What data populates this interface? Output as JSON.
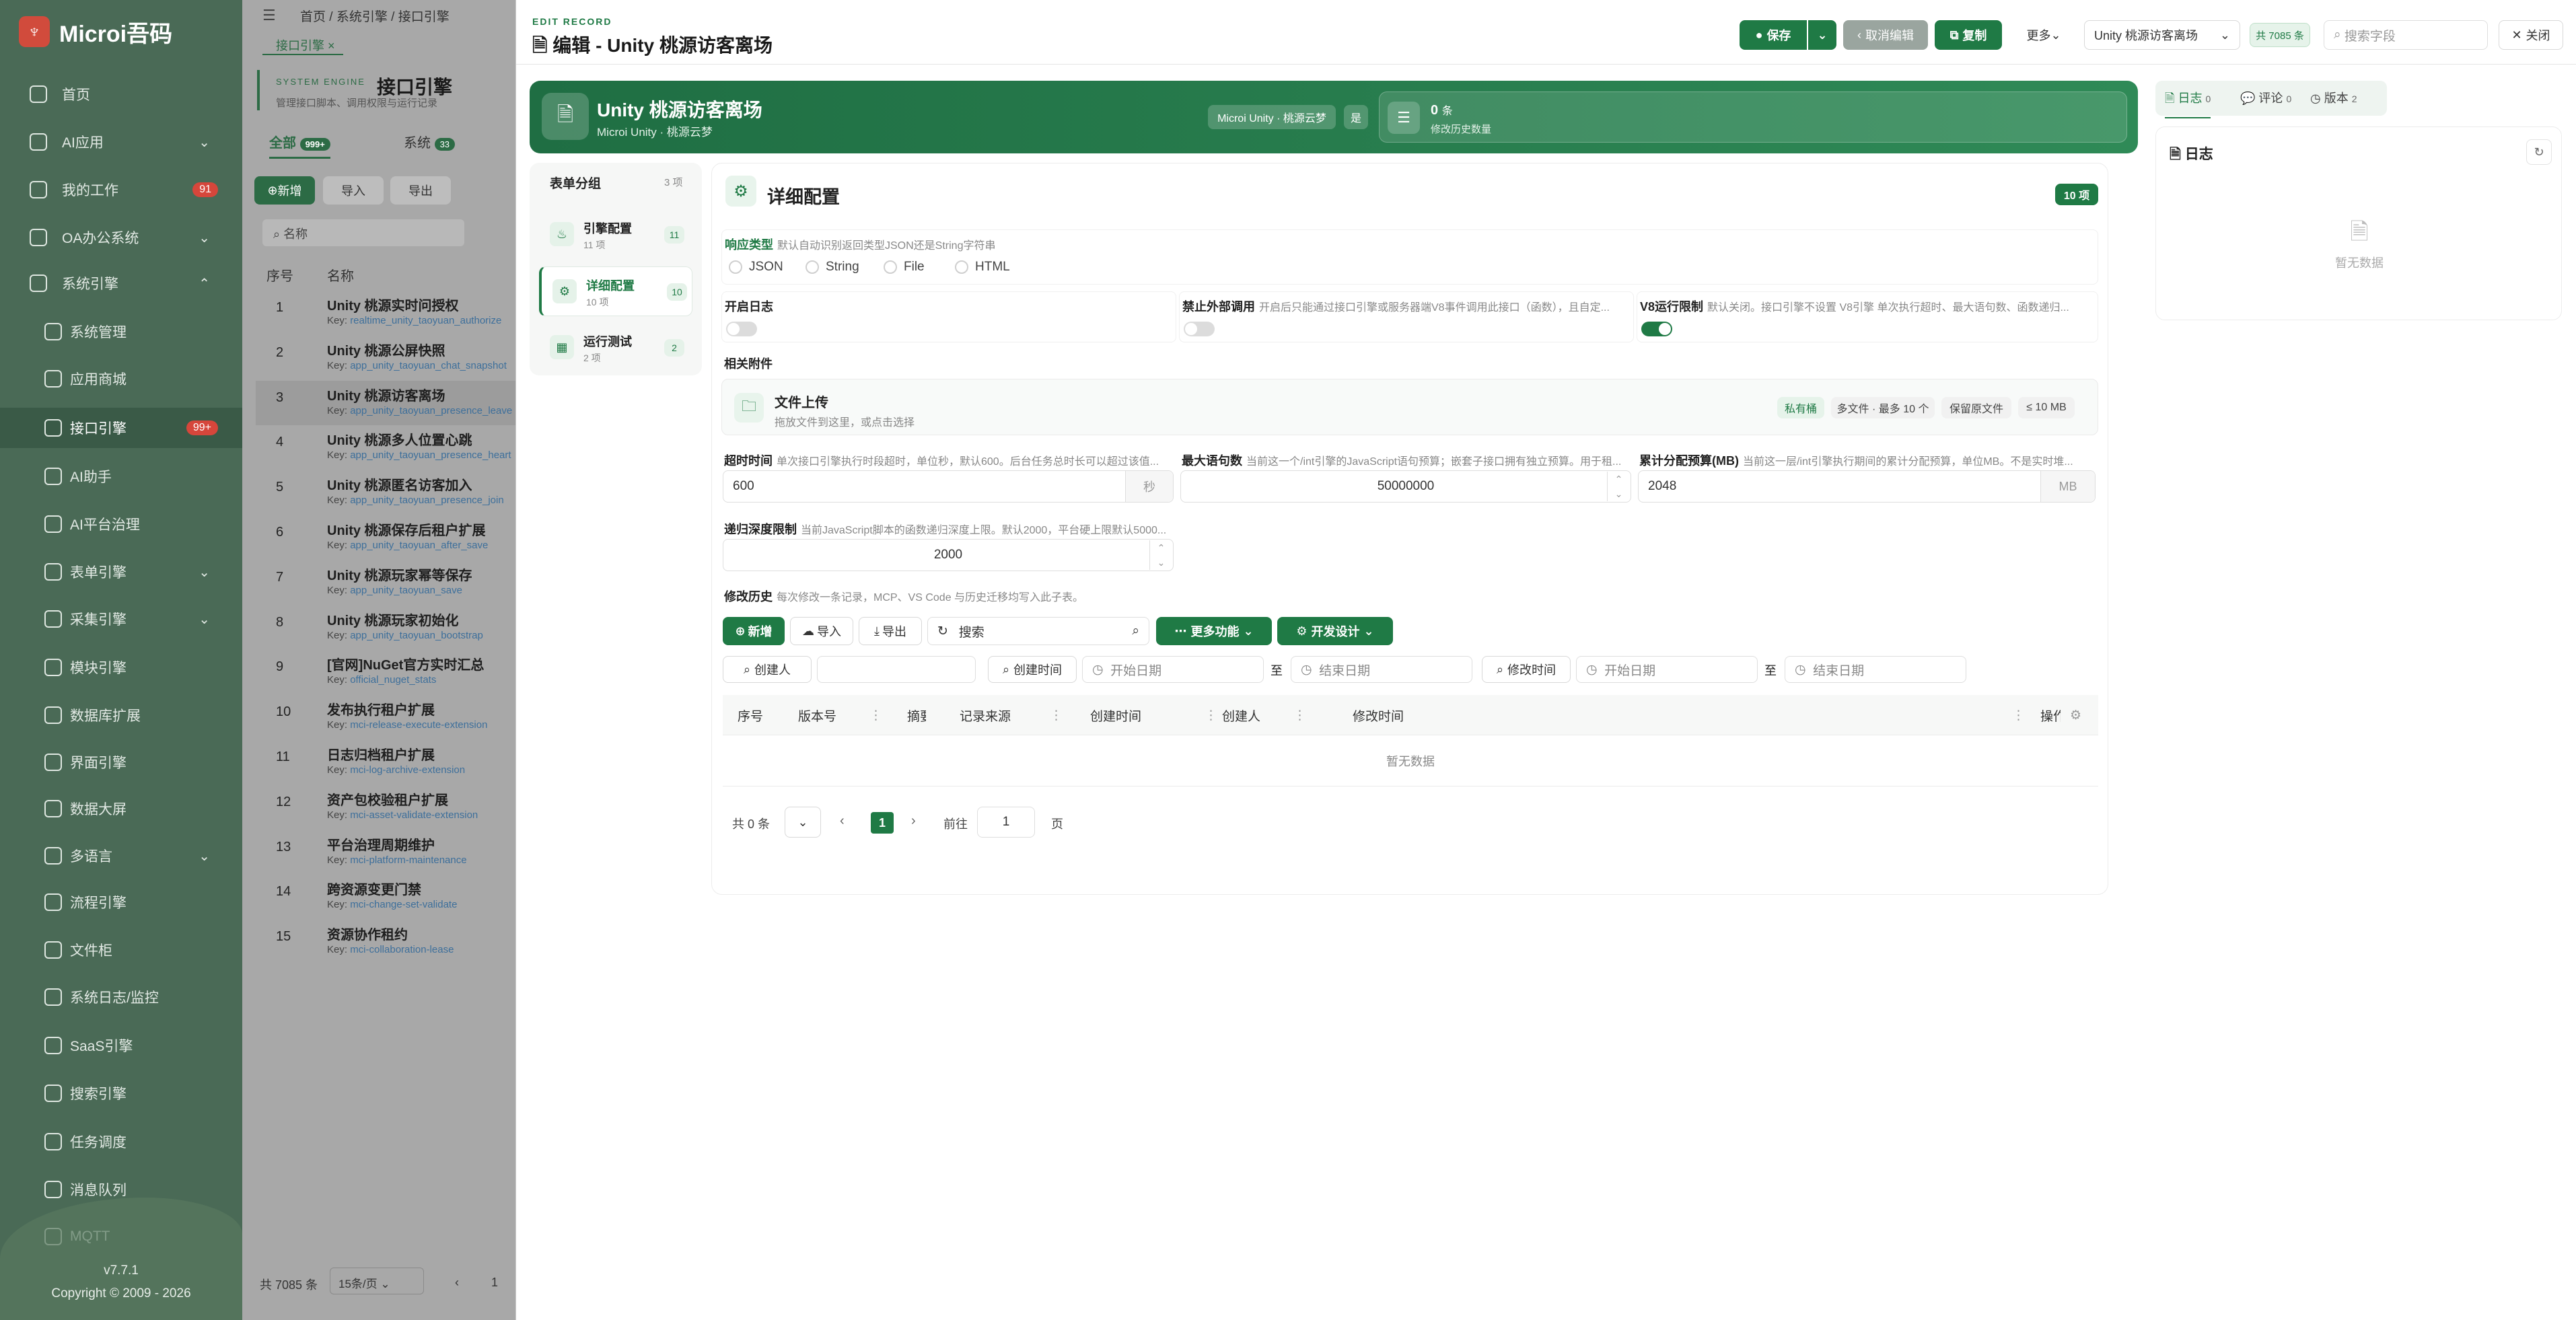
{
  "app": {
    "name": "Microi吾码",
    "version": "v7.7.1",
    "copyright": "Copyright © 2009 - 2026"
  },
  "sidebar": {
    "items": [
      {
        "label": "首页",
        "icon": "home-icon"
      },
      {
        "label": "AI应用",
        "icon": "ai-app-icon"
      },
      {
        "label": "我的工作",
        "icon": "work-icon",
        "badge": "91"
      },
      {
        "label": "OA办公系统",
        "icon": "office-icon"
      },
      {
        "label": "系统引擎",
        "icon": "gear-icon"
      },
      {
        "label": "系统管理",
        "icon": "settings-icon"
      },
      {
        "label": "应用商城",
        "icon": "store-icon"
      },
      {
        "label": "接口引擎",
        "icon": "link-icon",
        "badge": "99+"
      },
      {
        "label": "AI助手",
        "icon": "assistant-icon"
      },
      {
        "label": "AI平台治理",
        "icon": "platform-icon"
      },
      {
        "label": "表单引擎",
        "icon": "form-icon"
      },
      {
        "label": "采集引擎",
        "icon": "collect-icon"
      },
      {
        "label": "模块引擎",
        "icon": "module-icon"
      },
      {
        "label": "数据库扩展",
        "icon": "database-icon"
      },
      {
        "label": "界面引擎",
        "icon": "ui-icon"
      },
      {
        "label": "数据大屏",
        "icon": "dashboard-icon"
      },
      {
        "label": "多语言",
        "icon": "language-icon"
      },
      {
        "label": "流程引擎",
        "icon": "flow-icon"
      },
      {
        "label": "文件柜",
        "icon": "folder-icon"
      },
      {
        "label": "系统日志/监控",
        "icon": "monitor-icon"
      },
      {
        "label": "SaaS引擎",
        "icon": "saas-icon"
      },
      {
        "label": "搜索引擎",
        "icon": "search-icon"
      },
      {
        "label": "任务调度",
        "icon": "schedule-icon"
      },
      {
        "label": "消息队列",
        "icon": "queue-icon"
      },
      {
        "label": "MQTT",
        "icon": "mqtt-icon"
      }
    ]
  },
  "background": {
    "breadcrumb": [
      "首页",
      "系统引擎",
      "接口引擎"
    ],
    "tab": "接口引擎",
    "title": "接口引擎",
    "engine_tag": "SYSTEM ENGINE",
    "subtitle": "管理接口脚本、调用权限与运行记录",
    "tabs": [
      {
        "label": "全部",
        "count": "999+"
      },
      {
        "label": "系统",
        "count": "33"
      }
    ],
    "actions": [
      "新增",
      "导入",
      "导出"
    ],
    "search_placeholder": "名称",
    "columns": [
      "序号",
      "名称"
    ],
    "rows": [
      {
        "num": "1",
        "name": "Unity 桃源实时问授权",
        "key": "realtime_unity_taoyuan_authorize"
      },
      {
        "num": "2",
        "name": "Unity 桃源公屏快照",
        "key": "app_unity_taoyuan_chat_snapshot"
      },
      {
        "num": "3",
        "name": "Unity 桃源访客离场",
        "key": "app_unity_taoyuan_presence_leave"
      },
      {
        "num": "4",
        "name": "Unity 桃源多人位置心跳",
        "key": "app_unity_taoyuan_presence_heart"
      },
      {
        "num": "5",
        "name": "Unity 桃源匿名访客加入",
        "key": "app_unity_taoyuan_presence_join"
      },
      {
        "num": "6",
        "name": "Unity 桃源保存后租户扩展",
        "key": "app_unity_taoyuan_after_save"
      },
      {
        "num": "7",
        "name": "Unity 桃源玩家幂等保存",
        "key": "app_unity_taoyuan_save"
      },
      {
        "num": "8",
        "name": "Unity 桃源玩家初始化",
        "key": "app_unity_taoyuan_bootstrap"
      },
      {
        "num": "9",
        "name": "[官网]NuGet官方实时汇总",
        "key": "official_nuget_stats"
      },
      {
        "num": "10",
        "name": "发布执行租户扩展",
        "key": "mci-release-execute-extension"
      },
      {
        "num": "11",
        "name": "日志归档租户扩展",
        "key": "mci-log-archive-extension"
      },
      {
        "num": "12",
        "name": "资产包校验租户扩展",
        "key": "mci-asset-validate-extension"
      },
      {
        "num": "13",
        "name": "平台治理周期维护",
        "key": "mci-platform-maintenance"
      },
      {
        "num": "14",
        "name": "跨资源变更门禁",
        "key": "mci-change-set-validate"
      },
      {
        "num": "15",
        "name": "资源协作租约",
        "key": "mci-collaboration-lease"
      }
    ],
    "key_prefix": "Key:",
    "footer_total": "共 7085 条",
    "footer_pagesize": "15条/页",
    "footer_page": "1"
  },
  "drawer": {
    "eyebrow": "EDIT RECORD",
    "title": "编辑 - Unity 桃源访客离场",
    "toolbar": {
      "save": "保存",
      "cancel": "取消编辑",
      "copy": "复制",
      "more": "更多",
      "record_select": "Unity 桃源访客离场",
      "count_tag": "共 7085 条",
      "search_placeholder": "搜索字段",
      "close": "关闭"
    },
    "hero": {
      "title": "Unity 桃源访客离场",
      "subtitle": "Microi Unity · 桃源云梦",
      "tag1": "Microi Unity · 桃源云梦",
      "tag2": "是",
      "history_count": "0",
      "history_unit": "条",
      "history_label": "修改历史数量"
    },
    "groups": {
      "title": "表单分组",
      "count": "3 项",
      "items": [
        {
          "label": "引擎配置",
          "sub": "11 项",
          "count": "11"
        },
        {
          "label": "详细配置",
          "sub": "10 项",
          "count": "10"
        },
        {
          "label": "运行测试",
          "sub": "2 项",
          "count": "2"
        }
      ]
    },
    "section": {
      "title": "详细配置",
      "count": "10 项"
    },
    "fields": {
      "response_type": {
        "label": "响应类型",
        "desc": "默认自动识别返回类型JSON还是String字符串",
        "options": [
          "JSON",
          "String",
          "File",
          "HTML"
        ]
      },
      "enable_log": {
        "label": "开启日志",
        "on": false
      },
      "forbid_external": {
        "label": "禁止外部调用",
        "desc": "开启后只能通过接口引擎或服务器端V8事件调用此接口（函数），且自定...",
        "on": false
      },
      "v8_limit": {
        "label": "V8运行限制",
        "desc": "默认关闭。接口引擎不设置 V8引擎 单次执行超时、最大语句数、函数递归...",
        "on": true
      },
      "attachments": {
        "label": "相关附件",
        "upload_title": "文件上传",
        "upload_hint": "拖放文件到这里，或点击选择",
        "tags": [
          "私有桶",
          "多文件 · 最多 10 个",
          "保留原文件",
          "≤ 10 MB"
        ]
      },
      "timeout": {
        "label": "超时时间",
        "desc": "单次接口引擎执行时段超时，单位秒，默认600。后台任务总时长可以超过该值...",
        "value": "600",
        "unit": "秒"
      },
      "max_statements": {
        "label": "最大语句数",
        "desc": "当前这一个/int引擎的JavaScript语句预算；嵌套子接口拥有独立预算。用于租...",
        "value": "50000000"
      },
      "memory_budget": {
        "label": "累计分配预算(MB)",
        "desc": "当前这一层/int引擎执行期间的累计分配预算，单位MB。不是实时堆...",
        "value": "2048",
        "unit": "MB"
      },
      "recursion_limit": {
        "label": "递归深度限制",
        "desc": "当前JavaScript脚本的函数递归深度上限。默认2000，平台硬上限默认5000...",
        "value": "2000"
      }
    },
    "history": {
      "label": "修改历史",
      "desc": "每次修改一条记录，MCP、VS Code 与历史迁移均写入此子表。",
      "actions": {
        "add": "新增",
        "import": "导入",
        "export": "导出",
        "search_placeholder": "搜索",
        "more": "更多功能",
        "dev": "开发设计"
      },
      "filters": {
        "creator": "创建人",
        "created_time": "创建时间",
        "modified_time": "修改时间",
        "start_date": "开始日期",
        "end_date": "结束日期",
        "to": "至"
      },
      "columns": [
        "序号",
        "版本号",
        "摘要",
        "记录来源",
        "创建时间",
        "创建人",
        "修改时间",
        "操作"
      ],
      "empty": "暂无数据",
      "pagination": {
        "total": "共 0 条",
        "current": "1",
        "goto": "前往",
        "goto_value": "1",
        "page_unit": "页"
      }
    },
    "right_panel": {
      "tabs": [
        {
          "label": "日志",
          "count": "0"
        },
        {
          "label": "评论",
          "count": "0"
        },
        {
          "label": "版本",
          "count": "2"
        }
      ],
      "title": "日志",
      "empty": "暂无数据"
    }
  },
  "colors": {
    "brand": "#1f7a45",
    "sidebar": "#4a6a56",
    "badge": "#d6463b"
  }
}
